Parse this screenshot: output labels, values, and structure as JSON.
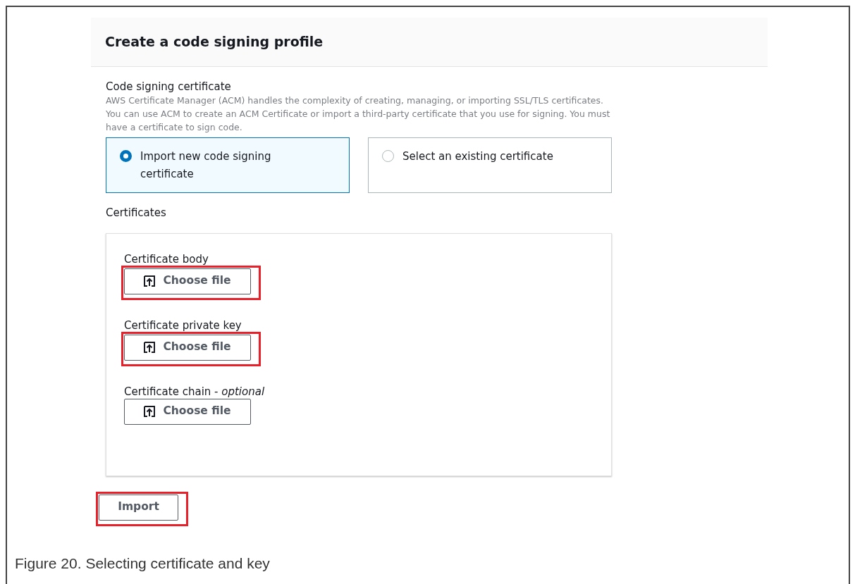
{
  "header": {
    "title": "Create a code signing profile"
  },
  "certificate_section": {
    "label": "Code signing certificate",
    "description": "AWS Certificate Manager (ACM) handles the complexity of creating, managing, or importing SSL/TLS certificates. You can use ACM to create an ACM Certificate or import a third-party certificate that you use for signing. You must have a certificate to sign code.",
    "options": [
      {
        "label": "Import new code signing certificate",
        "selected": true
      },
      {
        "label": "Select an existing certificate",
        "selected": false
      }
    ]
  },
  "certificates": {
    "label": "Certificates",
    "fields": [
      {
        "label": "Certificate body",
        "button": "Choose file",
        "highlighted": true
      },
      {
        "label": "Certificate private key",
        "button": "Choose file",
        "highlighted": true
      },
      {
        "label": "Certificate chain - *optional*",
        "button": "Choose file",
        "highlighted": false
      }
    ]
  },
  "import_button": {
    "label": "Import",
    "highlighted": true
  },
  "caption": "Figure 20.  Selecting certificate and key"
}
